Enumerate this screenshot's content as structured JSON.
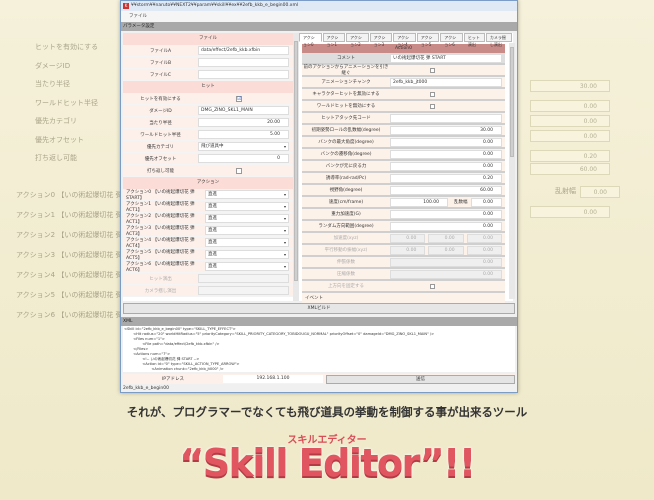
{
  "window": {
    "title": "¥¥storm¥¥naruto¥¥NEXT2¥¥param¥¥skill¥¥ex¥¥2efb_kkb_e_begin00.xml",
    "menu": [
      "ファイル"
    ],
    "param_header": "パラメータ設定",
    "status": "2efb_kkb_e_begin00"
  },
  "left": {
    "file_header": "ファイル",
    "files": [
      {
        "label": "ファイルA",
        "value": "data/effect/2efb_kkb.xfbin"
      },
      {
        "label": "ファイルB",
        "value": ""
      },
      {
        "label": "ファイルC",
        "value": ""
      }
    ],
    "hit_header": "ヒット",
    "hit": [
      {
        "label": "ヒットを有効にする",
        "type": "check",
        "value": "☑"
      },
      {
        "label": "ダメージID",
        "type": "text",
        "value": "DMG_ZINO_SKL1_MAIN"
      },
      {
        "label": "当たり半径",
        "type": "num",
        "value": "20.00"
      },
      {
        "label": "ワールドヒット半径",
        "type": "num",
        "value": "5.00"
      },
      {
        "label": "優先カテゴリ",
        "type": "sel",
        "value": "飛び道具中"
      },
      {
        "label": "優先オフセット",
        "type": "num",
        "value": "0"
      },
      {
        "label": "打ち返し可能",
        "type": "check",
        "value": ""
      }
    ],
    "action_header": "アクション",
    "actions": [
      {
        "label": "アクション0 【いの術起爆切花 弾 START】",
        "value": "直進"
      },
      {
        "label": "アクション1 【いの術起爆切花 弾 ACT1】",
        "value": "直進"
      },
      {
        "label": "アクション2 【いの術起爆切花 弾 ACT1】",
        "value": "直進"
      },
      {
        "label": "アクション3 【いの術起爆切花 弾 ACT3】",
        "value": "直進"
      },
      {
        "label": "アクション4 【いの術起爆切花 弾 ACT4】",
        "value": "直進"
      },
      {
        "label": "アクション5 【いの術起爆切花 弾 ACT5】",
        "value": "直進"
      },
      {
        "label": "アクション6 【いの術起爆切花 弾 ACT6】",
        "value": "直進"
      }
    ],
    "dim_rows": [
      "ヒット演出",
      "カメラ揺し演出"
    ]
  },
  "right": {
    "tabs": [
      "アクション0",
      "アクション1",
      "アクション2",
      "アクション3",
      "アクション4",
      "アクション5",
      "アクション6",
      "ヒット演出",
      "カメラ揺し演出"
    ],
    "header": "Action0",
    "rows": [
      {
        "label": "コメント",
        "value": "いの術起爆切花 弾 START",
        "type": "text",
        "cls": "gray"
      },
      {
        "label": "前のアクションからアニメーションを引き継ぐ",
        "type": "check"
      },
      {
        "label": "アニメーションチャンク",
        "value": "2efb_kkb_jt000",
        "type": "text"
      },
      {
        "label": "キャラクターヒットを無効にする",
        "type": "check"
      },
      {
        "label": "ワールドヒットを無効にする",
        "type": "check"
      },
      {
        "label": "ヒットアタック先コード",
        "value": "",
        "type": "text"
      },
      {
        "label": "初期姿勢ロールの乱数幅(degree)",
        "value": "30.00",
        "type": "num"
      },
      {
        "label": "バンクの最大角度(degree)",
        "value": "0.00",
        "type": "num"
      },
      {
        "label": "バンクの遷移角(degree)",
        "value": "0.00",
        "type": "num"
      },
      {
        "label": "バンクが元に戻る力",
        "value": "0.00",
        "type": "num"
      },
      {
        "label": "誘導率(rad-rad/Pc)",
        "value": "0.20",
        "type": "num"
      },
      {
        "label": "視野角(degree)",
        "value": "60.00",
        "type": "num"
      },
      {
        "label": "速度(cm/frame)",
        "value": "100.00",
        "type": "speed",
        "extra_label": "乱数幅",
        "extra_value": "0.00"
      },
      {
        "label": "重力加速度(G)",
        "value": "0.00",
        "type": "num"
      },
      {
        "label": "ランダム方向範囲(degree)",
        "value": "0.00",
        "type": "num"
      },
      {
        "label": "加速度(xyz)",
        "values": [
          "0.00",
          "0.00",
          "0.00"
        ],
        "type": "triple",
        "dis": true
      },
      {
        "label": "平行移動の振幅(xyz)",
        "values": [
          "0.00",
          "0.00",
          "0.00"
        ],
        "type": "triple",
        "dis": true
      },
      {
        "label": "伸張係数",
        "value": "0.00",
        "type": "num",
        "dis": true
      },
      {
        "label": "圧縮係数",
        "value": "0.00",
        "type": "num",
        "dis": true
      },
      {
        "label": "上方向を固定する",
        "type": "check",
        "dis": true
      },
      {
        "label": "イベント",
        "type": "none"
      }
    ]
  },
  "xml_build_label": "XMLビルド",
  "xml": {
    "header": "XML",
    "text": "<Skill id=\"2efb_kkb_e_begin00\" type=\"SKILL_TYPE_EFFECT\">\n        <Hit radius=\"20\" worldHitRadius=\"5\" priorityCategory=\"SKILL_PRIORITY_CATEGORY_TOBIDOUGU_NORMAL\" priorityOffset=\"0\" damageId=\"DMG_ZINO_SKL1_MAIN\" />\n        <Files num=\"1\">\n                <File path=\"data/effect/2efb_kkb.xfbin\" />\n        </Files>\n        <Actions num=\"7\">\n                <!-- いの術起爆切花 弾 START -->\n                <Action id=\"0\" type=\"SKILL_ACTION_TYPE_ARROW\">\n                        <Animation chunk=\"2efb_kkb_jt000\" />"
  },
  "ip": {
    "label": "IPアドレス",
    "value": "192.168.1.100",
    "send_label": "送信"
  },
  "caption": "それが、プログラマーでなくても飛び道具の挙動を制御する事が出来るツール",
  "logo": {
    "ruby": "スキルエディター",
    "title": "“Skill Editor”!!"
  },
  "ghost": {
    "left": [
      "ヒットを有効にする",
      "ダメージID",
      "当たり半径",
      "ワールドヒット半径",
      "優先カテゴリ",
      "優先オフセット",
      "打ち返し可能"
    ],
    "actions": [
      "アクション0 【いの術起爆切花 弾 ST",
      "アクション1 【いの術起爆切花 弾 AC",
      "アクション2 【いの術起爆切花 弾 AC",
      "アクション3 【いの術起爆切花 弾 AC",
      "アクション4 【いの術起爆切花 弾 AC",
      "アクション5 【いの術起爆切花 弾 AC",
      "アクション6 【いの術起爆切花 弾 AC"
    ],
    "right_values": [
      "30.00",
      "0.00",
      "0.00",
      "0.00",
      "0.20",
      "60.00",
      "乱射幅",
      "0.00",
      "0.00"
    ]
  }
}
